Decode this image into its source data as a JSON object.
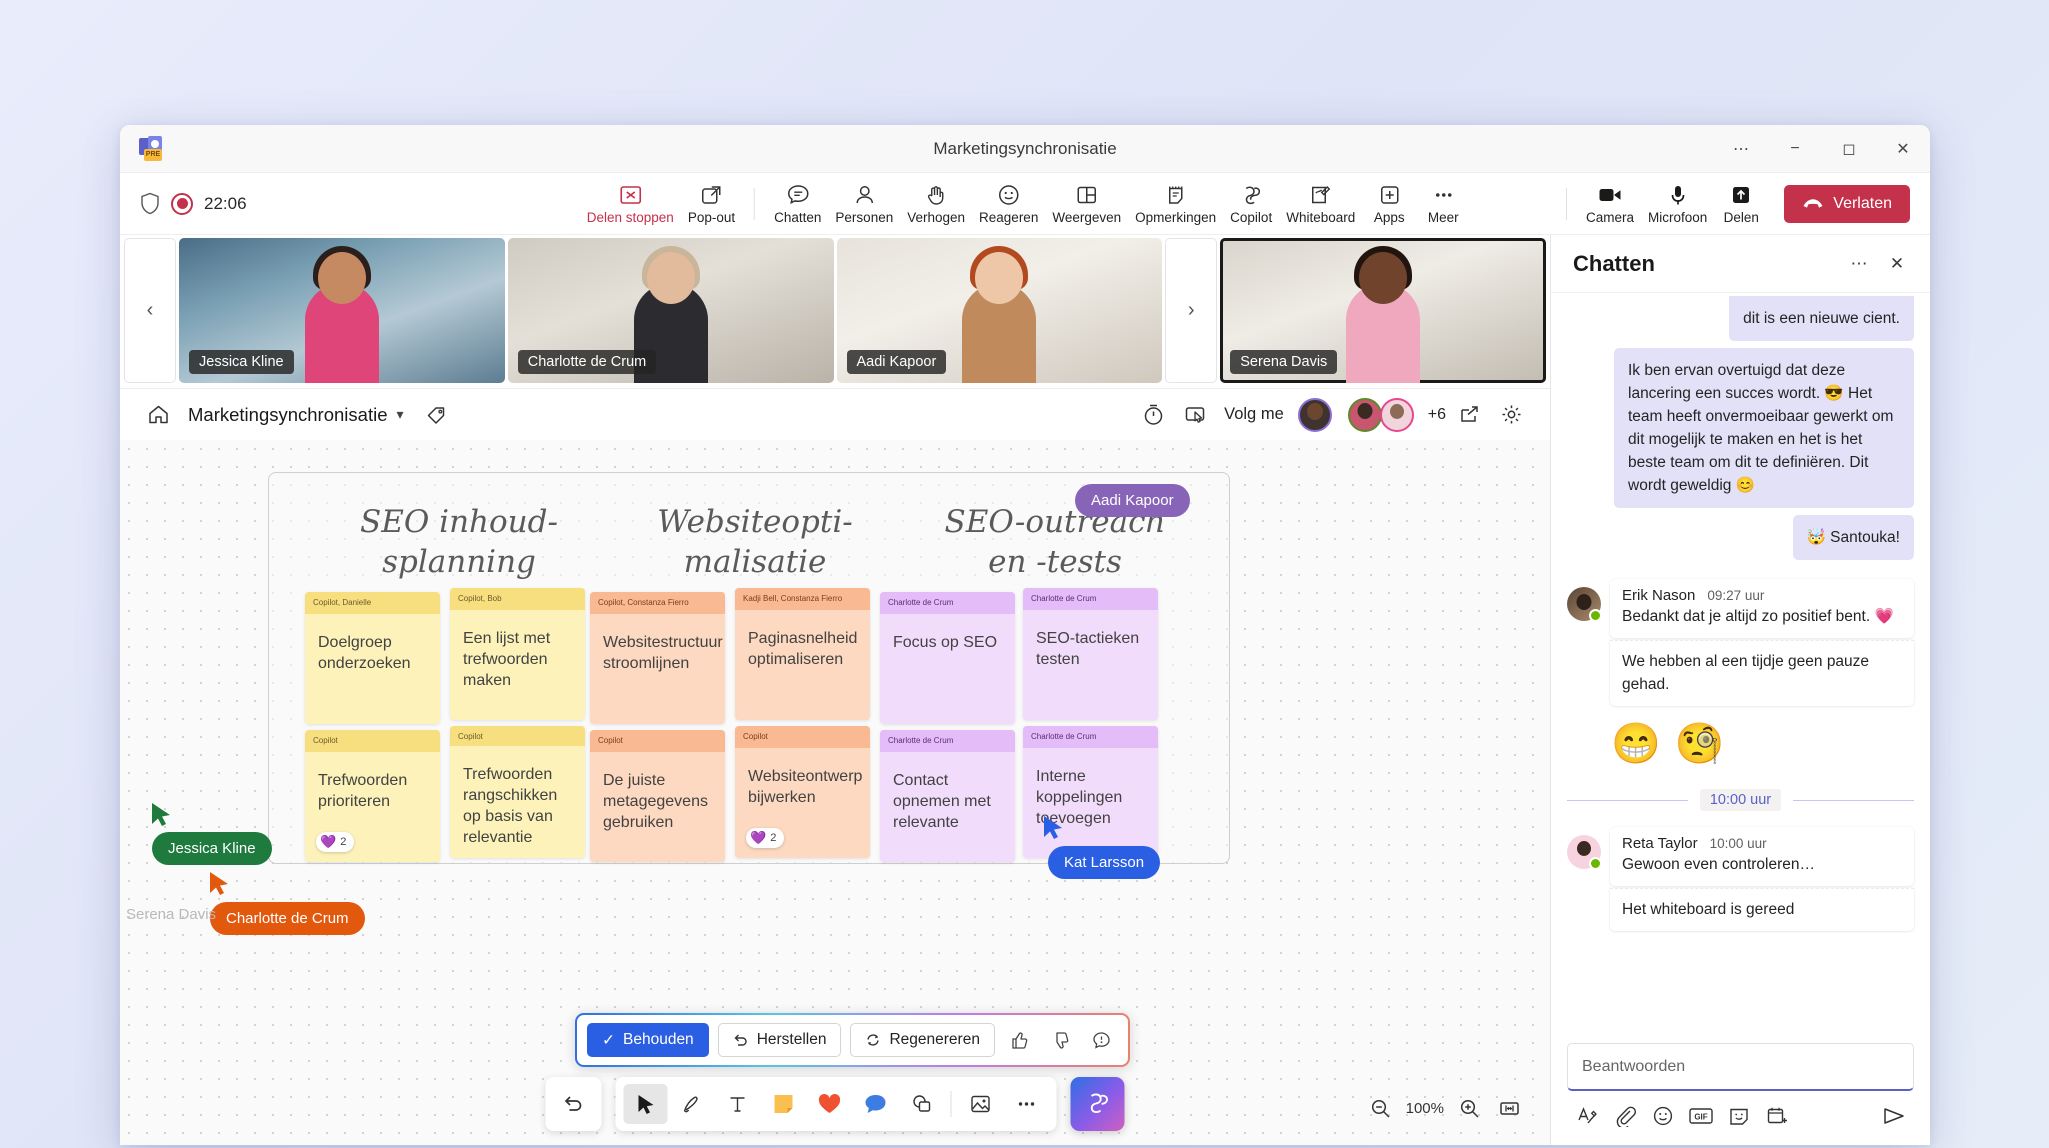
{
  "window": {
    "title": "Marketingsynchronisatie",
    "titlebar_buttons": [
      "more-options",
      "minimize",
      "maximize",
      "close"
    ]
  },
  "meeting_controls": {
    "recording_time": "22:06",
    "left_items": [
      {
        "name": "shield-icon",
        "label": ""
      },
      {
        "name": "record-indicator",
        "label": ""
      }
    ],
    "center_buttons": [
      {
        "icon": "stop-sharing-icon",
        "label": "Delen stoppen",
        "danger": true
      },
      {
        "icon": "pop-out-icon",
        "label": "Pop-out",
        "danger": false
      },
      {
        "icon": "chat-icon",
        "label": "Chatten",
        "danger": false
      },
      {
        "icon": "people-icon",
        "label": "Personen",
        "danger": false
      },
      {
        "icon": "raise-hand-icon",
        "label": "Verhogen",
        "danger": false
      },
      {
        "icon": "reactions-icon",
        "label": "Reageren",
        "danger": false
      },
      {
        "icon": "view-icon",
        "label": "Weergeven",
        "danger": false
      },
      {
        "icon": "notes-icon",
        "label": "Opmerkingen",
        "danger": false
      },
      {
        "icon": "copilot-icon",
        "label": "Copilot",
        "danger": false
      },
      {
        "icon": "whiteboard-icon",
        "label": "Whiteboard",
        "danger": false
      },
      {
        "icon": "apps-icon",
        "label": "Apps",
        "danger": false
      },
      {
        "icon": "more-icon",
        "label": "Meer",
        "danger": false
      }
    ],
    "right_buttons": [
      {
        "icon": "camera-icon",
        "label": "Camera"
      },
      {
        "icon": "microphone-icon",
        "label": "Microfoon"
      },
      {
        "icon": "share-icon",
        "label": "Delen"
      }
    ],
    "leave_label": "Verlaten",
    "leave_color": "#c4314b"
  },
  "filmstrip": {
    "prev_label": "‹",
    "next_label": "›",
    "tiles": [
      {
        "name": "Jessica Kline",
        "speaking": false
      },
      {
        "name": "Charlotte de Crum",
        "speaking": false
      },
      {
        "name": "Aadi Kapoor",
        "speaking": false
      },
      {
        "name": "Serena Davis",
        "speaking": true
      }
    ]
  },
  "whiteboard_header": {
    "home_icon": "home-icon",
    "title": "Marketingsynchronisatie",
    "chevron": "˅",
    "tag_icon": "tag-icon",
    "timer_icon": "timer-icon",
    "presenter_icon": "presenter-icon",
    "follow_label": "Volg me",
    "overflow_count": "+6",
    "share_icon": "share-board-icon",
    "settings_icon": "gear-icon"
  },
  "whiteboard": {
    "columns": [
      {
        "title_line1": "SEO inhoud-",
        "title_line2": "splanning"
      },
      {
        "title_line1": "Websiteopti-",
        "title_line2": "malisatie"
      },
      {
        "title_line1": "SEO-outreach",
        "title_line2": "en -tests"
      }
    ],
    "notes": [
      {
        "author": "Copilot, Danielle",
        "text": "Doelgroep onderzoeken",
        "color": "yellow",
        "reaction": null
      },
      {
        "author": "Copilot, Bob",
        "text": "Een lijst met trefwoorden maken",
        "color": "yellow",
        "reaction": null
      },
      {
        "author": "Copilot, Constanza Fierro",
        "text": "Websitestructuur stroomlijnen",
        "color": "orange",
        "reaction": null
      },
      {
        "author": "Kadji Bell, Constanza Fierro",
        "text": "Paginasnelheid optimaliseren",
        "color": "orange",
        "reaction": null
      },
      {
        "author": "Charlotte de Crum",
        "text": "Focus op SEO",
        "color": "purple",
        "reaction": null
      },
      {
        "author": "Charlotte de Crum",
        "text": "SEO-tactieken testen",
        "color": "purple",
        "reaction": null
      },
      {
        "author": "Copilot",
        "text": "Trefwoorden prioriteren",
        "color": "yellow",
        "reaction": "2"
      },
      {
        "author": "Copilot",
        "text": "Trefwoorden rangschikken op basis van relevantie",
        "color": "yellow",
        "reaction": null
      },
      {
        "author": "Copilot",
        "text": "De juiste metagegevens gebruiken",
        "color": "orange",
        "reaction": null
      },
      {
        "author": "Copilot",
        "text": "Websiteontwerp bijwerken",
        "color": "orange",
        "reaction": "2"
      },
      {
        "author": "Charlotte de Crum",
        "text": "Contact opnemen met relevante",
        "color": "purple",
        "reaction": null
      },
      {
        "author": "Charlotte de Crum",
        "text": "Interne koppelingen toevoegen",
        "color": "purple",
        "reaction": null
      }
    ],
    "cursors": [
      {
        "name": "Aadi Kapoor",
        "color": "#8764b8"
      },
      {
        "name": "Jessica Kline",
        "color": "#1f7a3d"
      },
      {
        "name": "Kat Larsson",
        "color": "#2b5fe3"
      },
      {
        "name": "Charlotte de Crum",
        "color": "#e2590e"
      },
      {
        "name": "Serena Davis",
        "color": "#b4b4b4"
      }
    ]
  },
  "copilot_bar": {
    "keep_label": "Behouden",
    "undo_label": "Herstellen",
    "regenerate_label": "Regenereren",
    "thumbs_up_icon": "thumbs-up-icon",
    "thumbs_down_icon": "thumbs-down-icon",
    "feedback_icon": "feedback-icon"
  },
  "whiteboard_tools": {
    "undo_icon": "undo-icon",
    "items": [
      {
        "icon": "select-arrow-icon",
        "active": true
      },
      {
        "icon": "pen-icon",
        "active": false
      },
      {
        "icon": "text-icon",
        "active": false
      },
      {
        "icon": "sticky-note-icon",
        "active": false
      },
      {
        "icon": "heart-reaction-icon",
        "active": false
      },
      {
        "icon": "comment-bubble-icon",
        "active": false
      },
      {
        "icon": "shapes-icon",
        "active": false
      },
      {
        "icon": "image-icon",
        "active": false
      },
      {
        "icon": "more-tools-icon",
        "active": false
      }
    ],
    "copilot_fab_icon": "copilot-fab-icon",
    "zoom_out_icon": "zoom-out-icon",
    "zoom_level": "100%",
    "zoom_in_icon": "zoom-in-icon",
    "fit_icon": "fit-to-screen-icon"
  },
  "chat": {
    "title": "Chatten",
    "more_icon": "more-options-icon",
    "close_icon": "close-icon",
    "messages": [
      {
        "type": "self",
        "text": "dit is een nieuwe cient.",
        "partial": true
      },
      {
        "type": "self",
        "text": "Ik ben ervan overtuigd dat deze lancering een succes wordt. 😎 Het team heeft onvermoeibaar gewerkt om dit mogelijk te maken en het is het beste team om dit te definiëren. Dit wordt geweldig 😊"
      },
      {
        "type": "self",
        "text": "🤯 Santouka!"
      },
      {
        "type": "other",
        "author": "Erik Nason",
        "time": "09:27 uur",
        "text": "Bedankt dat je altijd zo positief bent. 💗"
      },
      {
        "type": "other-cont",
        "text": "We hebben al een tijdje geen pauze gehad."
      },
      {
        "type": "emojis",
        "emojis": [
          "😁",
          "🧐"
        ]
      },
      {
        "type": "separator",
        "label": "10:00 uur"
      },
      {
        "type": "other",
        "author": "Reta Taylor",
        "time": "10:00 uur",
        "text": "Gewoon even controleren…"
      },
      {
        "type": "other-cont",
        "text": "Het whiteboard is gereed"
      }
    ],
    "compose_placeholder": "Beantwoorden",
    "compose_tools": [
      "format-icon",
      "attach-icon",
      "emoji-icon",
      "gif-icon",
      "sticker-icon",
      "schedule-icon"
    ],
    "send_icon": "send-icon"
  }
}
